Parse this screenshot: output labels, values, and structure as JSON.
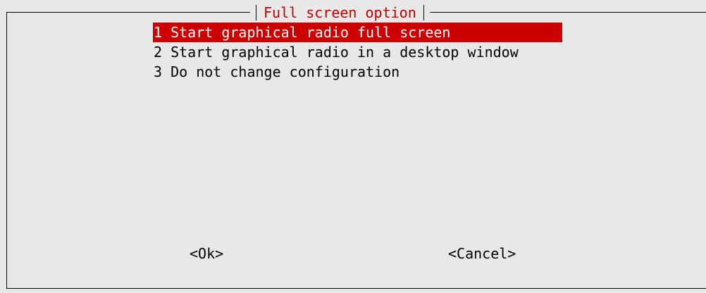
{
  "dialog": {
    "title": "Full screen option"
  },
  "menu": {
    "items": [
      {
        "label": "1 Start graphical radio full screen",
        "selected": true
      },
      {
        "label": "2 Start graphical radio in a desktop window",
        "selected": false
      },
      {
        "label": "3 Do not change configuration",
        "selected": false
      }
    ]
  },
  "buttons": {
    "ok_label": "<Ok>",
    "cancel_label": "<Cancel>"
  },
  "colors": {
    "background": "#e8e8e8",
    "selection": "#cc0000",
    "title_text": "#c00000"
  }
}
